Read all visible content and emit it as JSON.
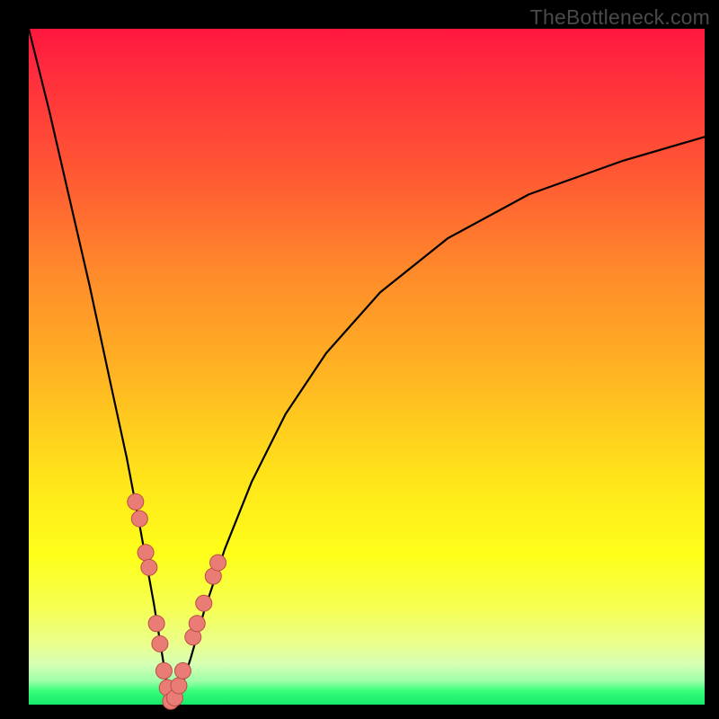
{
  "watermark": "TheBottleneck.com",
  "colors": {
    "frame": "#000000",
    "curve_stroke": "#000000",
    "marker_fill": "#e97c74",
    "marker_stroke": "#bb4e46"
  },
  "chart_data": {
    "type": "line",
    "title": "",
    "xlabel": "",
    "ylabel": "",
    "xlim": [
      0,
      100
    ],
    "ylim": [
      0,
      100
    ],
    "note": "No axis ticks or numeric labels are visible; x and y are normalized 0–100. Curve is a V-shaped function with the minimum near x≈21, y≈0, rising steeply on the left to y≈100 at x≈0 and asymptotically toward y≈84 on the right at x≈100.",
    "series": [
      {
        "name": "curve",
        "x": [
          0,
          3,
          6,
          9,
          12,
          14.5,
          16.5,
          18.5,
          19.8,
          20.6,
          21.4,
          22.4,
          24.0,
          26.0,
          29.0,
          33.0,
          38.0,
          44.0,
          52.0,
          62.0,
          74.0,
          88.0,
          100.0
        ],
        "y": [
          100,
          88,
          75,
          62,
          48,
          36.5,
          26.0,
          15.0,
          7.0,
          2.0,
          0.3,
          2.0,
          7.0,
          14.0,
          23.0,
          33.0,
          43.0,
          52.0,
          61.0,
          69.0,
          75.5,
          80.5,
          84.0
        ]
      }
    ],
    "markers": {
      "name": "highlighted-points",
      "note": "Pink circular markers clustered near the bottom of the V on both arms.",
      "x": [
        15.8,
        16.4,
        17.3,
        17.8,
        18.9,
        19.4,
        20.0,
        20.5,
        21.0,
        21.6,
        22.2,
        22.8,
        24.3,
        24.9,
        25.9,
        27.3,
        28.0
      ],
      "y": [
        30.0,
        27.5,
        22.5,
        20.3,
        12.0,
        9.0,
        5.0,
        2.5,
        0.5,
        1.0,
        2.8,
        5.0,
        10.0,
        12.0,
        15.0,
        19.0,
        21.0
      ]
    }
  }
}
